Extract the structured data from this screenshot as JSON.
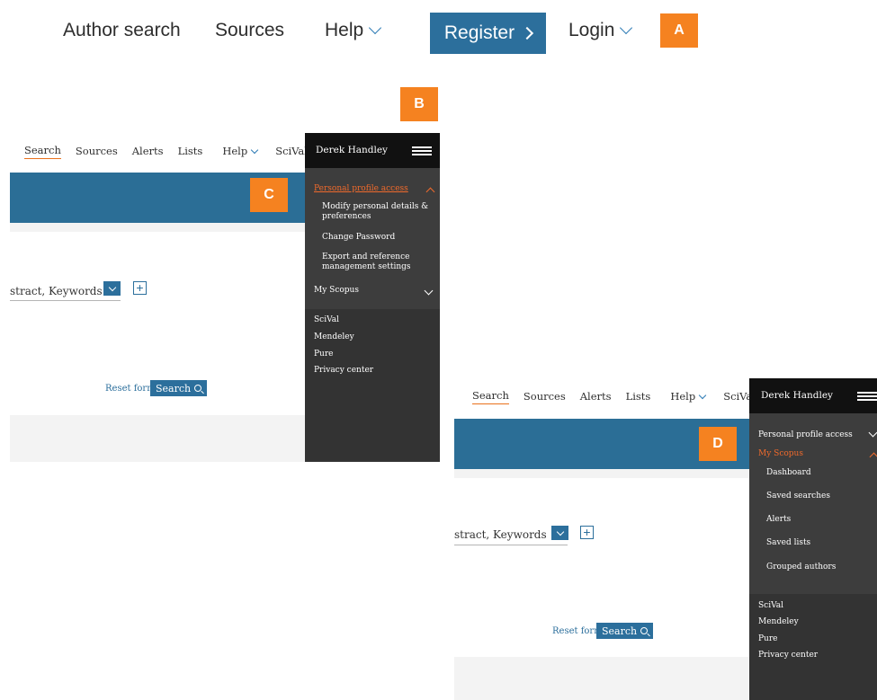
{
  "top_nav": {
    "author_search": "Author search",
    "sources": "Sources",
    "help": "Help",
    "register": "Register",
    "login": "Login"
  },
  "badges": {
    "a": "A",
    "b": "B",
    "c": "C",
    "d": "D"
  },
  "panel_nav": {
    "search": "Search",
    "sources": "Sources",
    "alerts": "Alerts",
    "lists": "Lists",
    "help": "Help",
    "scival": "SciVal",
    "scival_ext": "»"
  },
  "search_form": {
    "field_value": "stract, Keywords",
    "plus": "+",
    "reset": "Reset form",
    "search": "Search"
  },
  "menu": {
    "user_name": "Derek Handley",
    "personal_profile": "Personal profile access",
    "modify_details": "Modify personal details & preferences",
    "change_password": "Change Password",
    "export_settings": "Export and reference management settings",
    "my_scopus": "My Scopus",
    "dashboard": "Dashboard",
    "saved_searches": "Saved searches",
    "alerts": "Alerts",
    "saved_lists": "Saved lists",
    "grouped_authors": "Grouped authors",
    "scival": "SciVal",
    "mendeley": "Mendeley",
    "pure": "Pure",
    "privacy_center": "Privacy center"
  },
  "colors": {
    "brand_blue": "#2c6f9c",
    "badge_orange": "#f58220",
    "menu_dark": "#3d3d3d",
    "menu_header": "#111111",
    "active_orange": "#f06a2c"
  }
}
